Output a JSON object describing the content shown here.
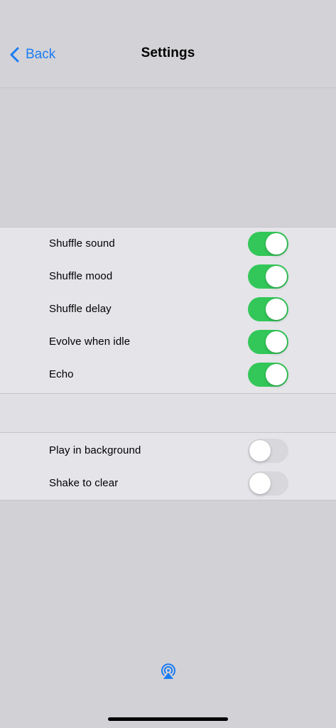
{
  "navbar": {
    "back_label": "Back",
    "title": "Settings"
  },
  "section1": {
    "rows": [
      {
        "label": "Shuffle sound",
        "on": true
      },
      {
        "label": "Shuffle mood",
        "on": true
      },
      {
        "label": "Shuffle delay",
        "on": true
      },
      {
        "label": "Evolve when idle",
        "on": true
      },
      {
        "label": "Echo",
        "on": true
      }
    ]
  },
  "section2": {
    "rows": [
      {
        "label": "Play in background",
        "on": false
      },
      {
        "label": "Shake to clear",
        "on": false
      }
    ]
  },
  "icons": {
    "back": "chevron-left-icon",
    "airplay": "airplay-icon"
  },
  "colors": {
    "accent": "#1a7cf4",
    "toggle_on": "#33c759",
    "toggle_off": "#d8d7dc"
  }
}
